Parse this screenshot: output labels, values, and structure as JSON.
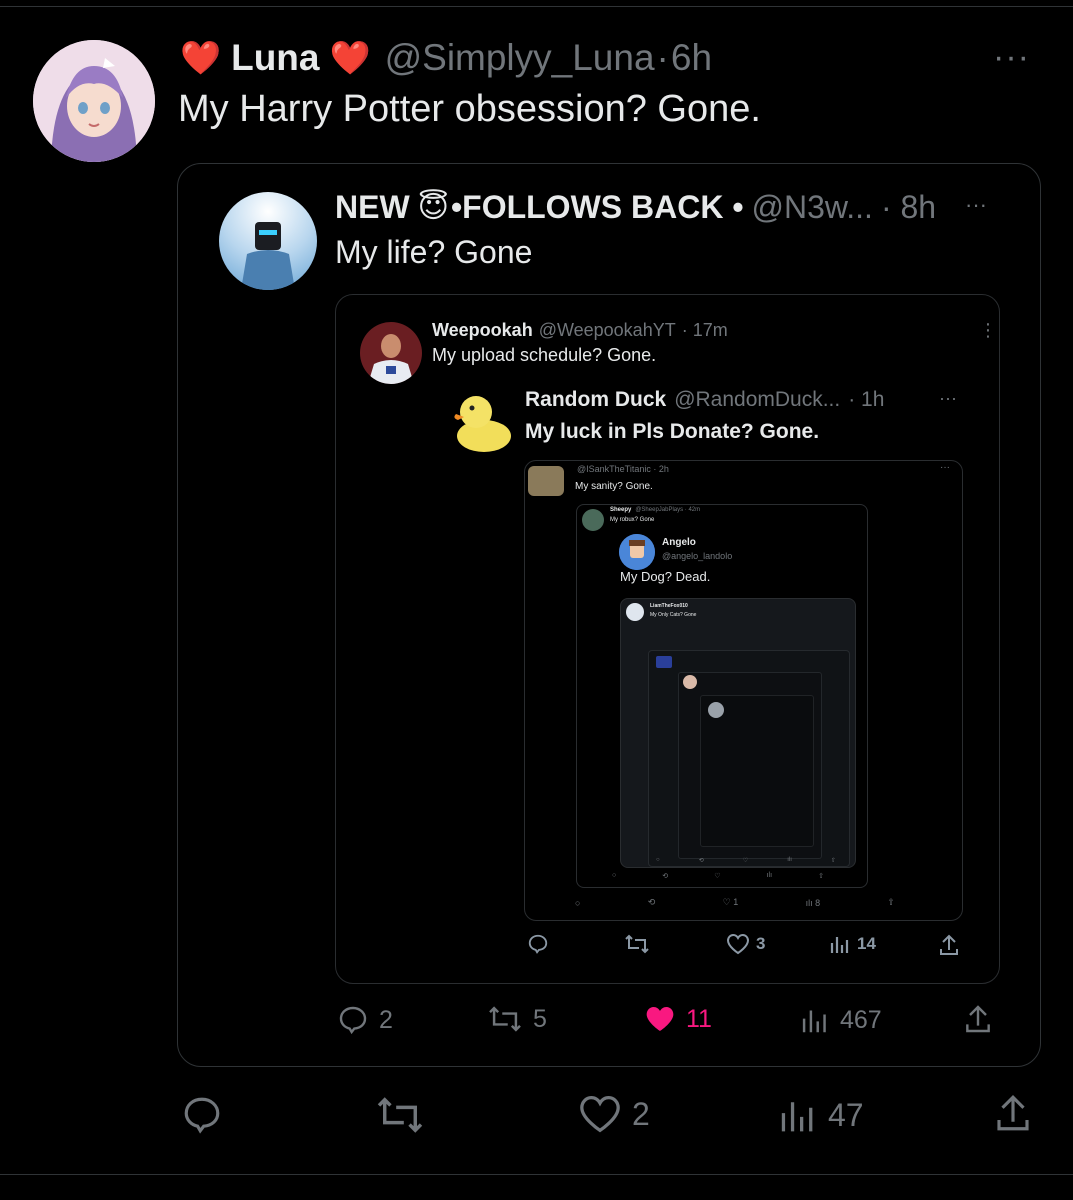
{
  "tweet": {
    "display_name": "Luna",
    "heart_emoji": "❤️",
    "handle": "@Simplyy_Luna",
    "separator": "·",
    "time": "6h",
    "text": "My Harry Potter obsession? Gone.",
    "more": "···",
    "actions": {
      "replies": "",
      "retweets": "",
      "likes": "2",
      "views": "47"
    }
  },
  "quote1": {
    "name_prefix": "NEW",
    "emoji": "😇",
    "name_suffix": "•FOLLOWS BACK •",
    "handle": "@N3w...",
    "time": "· 8h",
    "text": "My life? Gone",
    "more": "···",
    "actions": {
      "replies": "2",
      "retweets": "5",
      "likes": "11",
      "views": "467"
    }
  },
  "quote2": {
    "name": "Weepookah",
    "handle": "@WeepookahYT",
    "time": "· 17m",
    "text": "My upload schedule? Gone.",
    "more": "⋮"
  },
  "quote3": {
    "name": "Random Duck",
    "handle": "@RandomDuck...",
    "time": "· 1h",
    "text": "My luck in Pls Donate? Gone.",
    "more": "···",
    "actions": {
      "likes": "3",
      "views": "14"
    }
  },
  "quote4": {
    "handle": "@ISankTheTitanic · 2h",
    "text": "My sanity? Gone.",
    "actions": {
      "likes": "1",
      "views": "8"
    }
  },
  "quote5": {
    "name": "Sheepy",
    "handle": "@SheepJabPlays · 42m",
    "text": "My robux? Gone"
  },
  "quote6": {
    "name": "Angelo",
    "handle": "@angelo_landolo",
    "text": "My Dog? Dead."
  },
  "quote7": {
    "name": "LiamTheFox010",
    "text": "My Only Cats? Gone"
  },
  "colors": {
    "background": "#000000",
    "muted": "#71767b",
    "like_pink": "#f91880",
    "text": "#e7e9ea"
  }
}
